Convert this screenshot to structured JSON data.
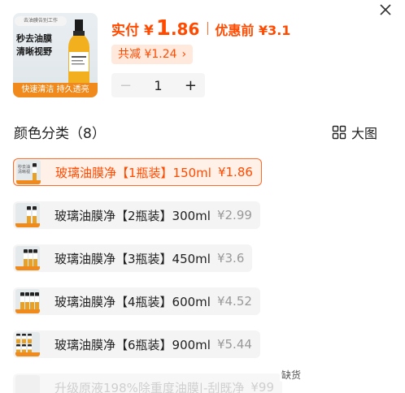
{
  "product": {
    "thumb_tag": "去油膜告别工作",
    "thumb_headline_1": "秒去油膜",
    "thumb_headline_2": "清晰视野",
    "thumb_banner": "快速清洁 持久透亮"
  },
  "price": {
    "label": "实付",
    "currency": "¥",
    "integer": "1",
    "decimal": ".86",
    "original": "优惠前 ¥3.1"
  },
  "discount": {
    "text": "共减 ¥1.24",
    "chevron": "›"
  },
  "quantity": {
    "minus": "−",
    "value": "1",
    "plus": "+"
  },
  "section": {
    "title": "颜色分类（8）",
    "view_label": "大图",
    "view_icon": "grid-icon"
  },
  "options": [
    {
      "name": "玻璃油膜净【1瓶装】150ml",
      "price": "¥1.86",
      "selected": true,
      "bottles": 1
    },
    {
      "name": "玻璃油膜净【2瓶装】300ml",
      "price": "¥2.99",
      "selected": false,
      "bottles": 2
    },
    {
      "name": "玻璃油膜净【3瓶装】450ml",
      "price": "¥3.6",
      "selected": false,
      "bottles": 3
    },
    {
      "name": "玻璃油膜净【4瓶装】600ml",
      "price": "¥4.52",
      "selected": false,
      "bottles": 4
    },
    {
      "name": "玻璃油膜净【6瓶装】900ml",
      "price": "¥5.44",
      "selected": false,
      "bottles": 6
    },
    {
      "name": "升级原液198%除重度油膜|-刮既净",
      "price": "¥99",
      "selected": false,
      "disabled": true
    }
  ],
  "soldout_label": "缺货",
  "colors": {
    "accent": "#ff4a00",
    "banner": "#f08a1c",
    "discount_bg": "#ffe9dc"
  }
}
